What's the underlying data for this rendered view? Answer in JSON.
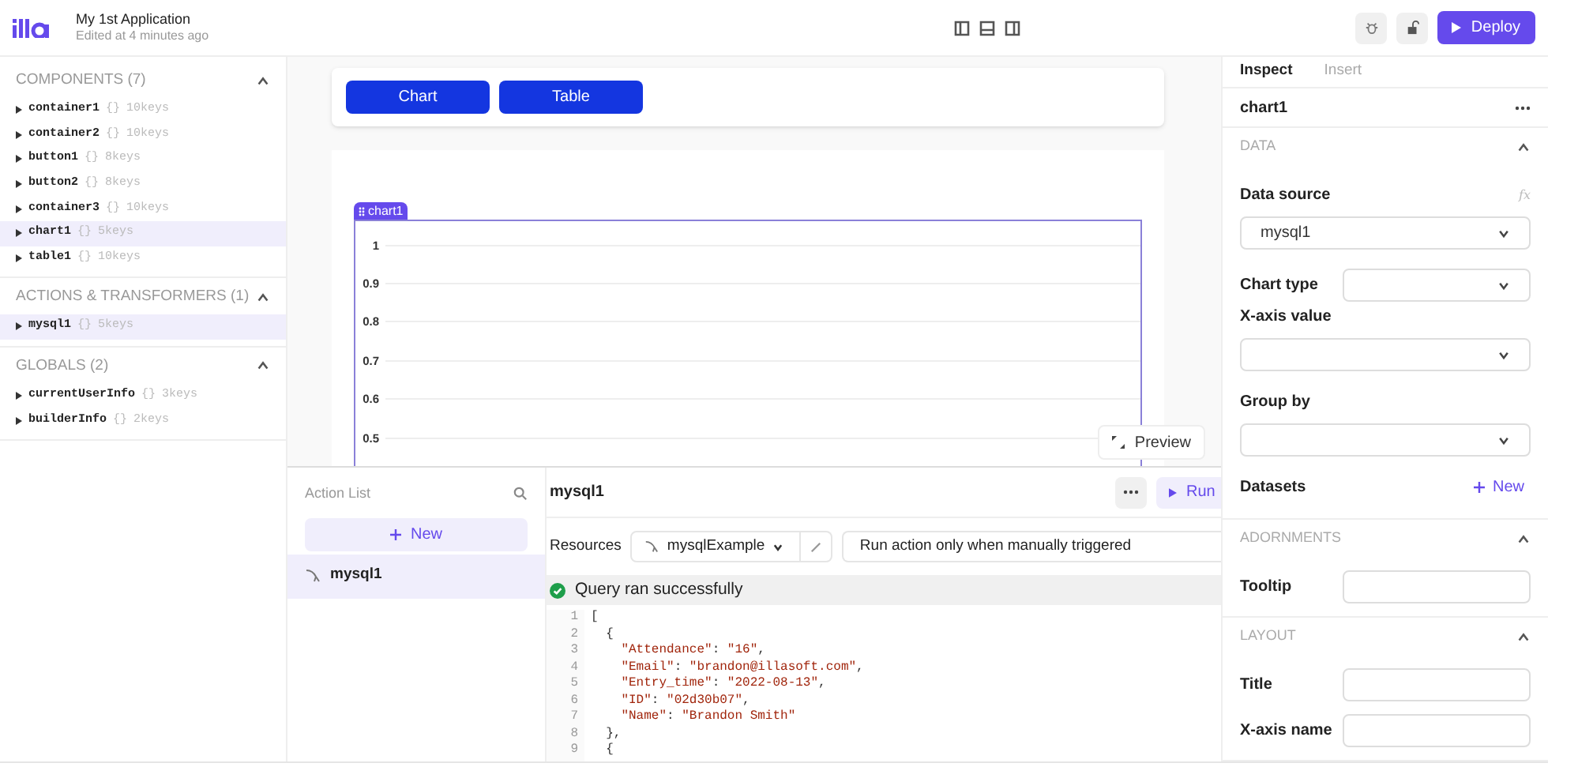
{
  "header": {
    "app_name": "My 1st Application",
    "edited": "Edited at 4 minutes ago",
    "deploy": "Deploy"
  },
  "sidebar": {
    "sections": [
      {
        "title": "COMPONENTS (7)",
        "expanded": true,
        "items": [
          {
            "name": "container1",
            "braces": "{}",
            "keys": "10keys",
            "selected": false
          },
          {
            "name": "container2",
            "braces": "{}",
            "keys": "10keys",
            "selected": false
          },
          {
            "name": "button1",
            "braces": "{}",
            "keys": "8keys",
            "selected": false
          },
          {
            "name": "button2",
            "braces": "{}",
            "keys": "8keys",
            "selected": false
          },
          {
            "name": "container3",
            "braces": "{}",
            "keys": "10keys",
            "selected": false
          },
          {
            "name": "chart1",
            "braces": "{}",
            "keys": "5keys",
            "selected": true
          },
          {
            "name": "table1",
            "braces": "{}",
            "keys": "10keys",
            "selected": false
          }
        ]
      },
      {
        "title": "ACTIONS & TRANSFORMERS (1)",
        "expanded": true,
        "items": [
          {
            "name": "mysql1",
            "braces": "{}",
            "keys": "5keys",
            "selected": true
          }
        ]
      },
      {
        "title": "GLOBALS (2)",
        "expanded": true,
        "items": [
          {
            "name": "currentUserInfo",
            "braces": "{}",
            "keys": "3keys",
            "selected": false
          },
          {
            "name": "builderInfo",
            "braces": "{}",
            "keys": "2keys",
            "selected": false
          }
        ]
      }
    ]
  },
  "canvas": {
    "buttons": [
      "Chart",
      "Table"
    ],
    "chart": {
      "tag": "chart1",
      "y_ticks": [
        "1",
        "0.9",
        "0.8",
        "0.7",
        "0.6",
        "0.5"
      ]
    },
    "preview": "Preview"
  },
  "action_panel": {
    "list_title": "Action List",
    "new_button": "New",
    "actions": [
      {
        "name": "mysql1",
        "selected": true
      }
    ],
    "editor": {
      "title": "mysql1",
      "run": "Run",
      "resources_label": "Resources",
      "resource": "mysqlExample",
      "trigger": "Run action only when manually triggered",
      "status": "Query ran successfully",
      "code": [
        {
          "line": "1",
          "text": "["
        },
        {
          "line": "2",
          "text": "  {"
        },
        {
          "line": "3",
          "text": "    \"Attendance\": \"16\","
        },
        {
          "line": "4",
          "text": "    \"Email\": \"brandon@illasoft.com\","
        },
        {
          "line": "5",
          "text": "    \"Entry_time\": \"2022-08-13\","
        },
        {
          "line": "6",
          "text": "    \"ID\": \"02d30b07\","
        },
        {
          "line": "7",
          "text": "    \"Name\": \"Brandon Smith\""
        },
        {
          "line": "8",
          "text": "  },"
        },
        {
          "line": "9",
          "text": "  {"
        }
      ]
    }
  },
  "inspector": {
    "tabs": [
      {
        "label": "Inspect",
        "selected": true
      },
      {
        "label": "Insert",
        "selected": false
      }
    ],
    "component": "chart1",
    "sections": [
      {
        "title": "DATA",
        "expanded": true,
        "fields": [
          {
            "kind": "stacked-select",
            "label": "Data source",
            "value": "mysql1",
            "hint": "fx"
          },
          {
            "kind": "inline-select",
            "label": "Chart type"
          },
          {
            "kind": "stacked-select",
            "label": "X-axis value"
          },
          {
            "kind": "stacked-select",
            "label": "Group by"
          },
          {
            "kind": "action",
            "label": "Datasets",
            "action": "New"
          }
        ]
      },
      {
        "title": "ADORNMENTS",
        "expanded": true,
        "fields": [
          {
            "kind": "inline-input",
            "label": "Tooltip"
          }
        ]
      },
      {
        "title": "LAYOUT",
        "expanded": true,
        "fields": [
          {
            "kind": "inline-input",
            "label": "Title"
          },
          {
            "kind": "inline-input",
            "label": "X-axis name"
          }
        ]
      }
    ]
  }
}
